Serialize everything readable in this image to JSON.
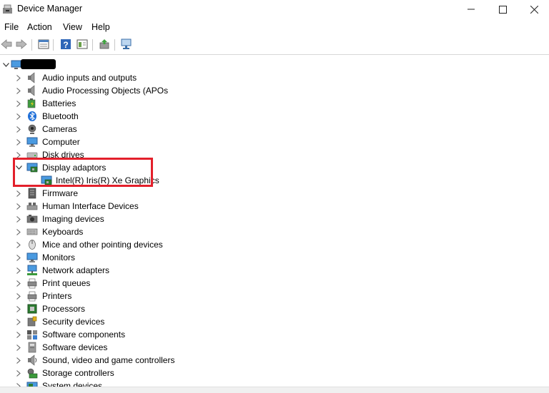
{
  "window": {
    "title": "Device Manager",
    "controls": [
      "minimize",
      "maximize",
      "close"
    ]
  },
  "menu": [
    "File",
    "Action",
    "View",
    "Help"
  ],
  "toolbar": [
    "back-icon",
    "forward-icon",
    "properties-icon",
    "help-icon",
    "view-icon",
    "update-driver-icon",
    "scan-hardware-icon"
  ],
  "tree": {
    "root_label": "",
    "categories": [
      {
        "label": "Audio inputs and outputs",
        "icon": "speaker-icon",
        "expanded": false
      },
      {
        "label": "Audio Processing Objects (APOs",
        "icon": "speaker-icon",
        "expanded": false
      },
      {
        "label": "Batteries",
        "icon": "battery-icon",
        "expanded": false
      },
      {
        "label": "Bluetooth",
        "icon": "bluetooth-icon",
        "expanded": false
      },
      {
        "label": "Cameras",
        "icon": "camera-icon",
        "expanded": false
      },
      {
        "label": "Computer",
        "icon": "computer-icon",
        "expanded": false
      },
      {
        "label": "Disk drives",
        "icon": "disk-icon",
        "expanded": false
      },
      {
        "label": "Display adaptors",
        "icon": "display-adapter-icon",
        "expanded": true,
        "children": [
          {
            "label": "Intel(R) Iris(R) Xe Graphics",
            "icon": "display-adapter-icon"
          }
        ]
      },
      {
        "label": "Firmware",
        "icon": "firmware-icon",
        "expanded": false
      },
      {
        "label": "Human Interface Devices",
        "icon": "hid-icon",
        "expanded": false
      },
      {
        "label": "Imaging devices",
        "icon": "imaging-icon",
        "expanded": false
      },
      {
        "label": "Keyboards",
        "icon": "keyboard-icon",
        "expanded": false
      },
      {
        "label": "Mice and other pointing devices",
        "icon": "mouse-icon",
        "expanded": false
      },
      {
        "label": "Monitors",
        "icon": "monitor-icon",
        "expanded": false
      },
      {
        "label": "Network adapters",
        "icon": "network-icon",
        "expanded": false
      },
      {
        "label": "Print queues",
        "icon": "print-queue-icon",
        "expanded": false
      },
      {
        "label": "Printers",
        "icon": "printer-icon",
        "expanded": false
      },
      {
        "label": "Processors",
        "icon": "processor-icon",
        "expanded": false
      },
      {
        "label": "Security devices",
        "icon": "security-icon",
        "expanded": false
      },
      {
        "label": "Software components",
        "icon": "software-component-icon",
        "expanded": false
      },
      {
        "label": "Software devices",
        "icon": "software-device-icon",
        "expanded": false
      },
      {
        "label": "Sound, video and game controllers",
        "icon": "sound-icon",
        "expanded": false
      },
      {
        "label": "Storage controllers",
        "icon": "storage-icon",
        "expanded": false
      },
      {
        "label": "System devices",
        "icon": "system-icon",
        "expanded": false
      }
    ]
  },
  "colors": {
    "highlight_box": "#e3202b",
    "chevron": "#555555",
    "icon_blue": "#3a8ad8"
  }
}
